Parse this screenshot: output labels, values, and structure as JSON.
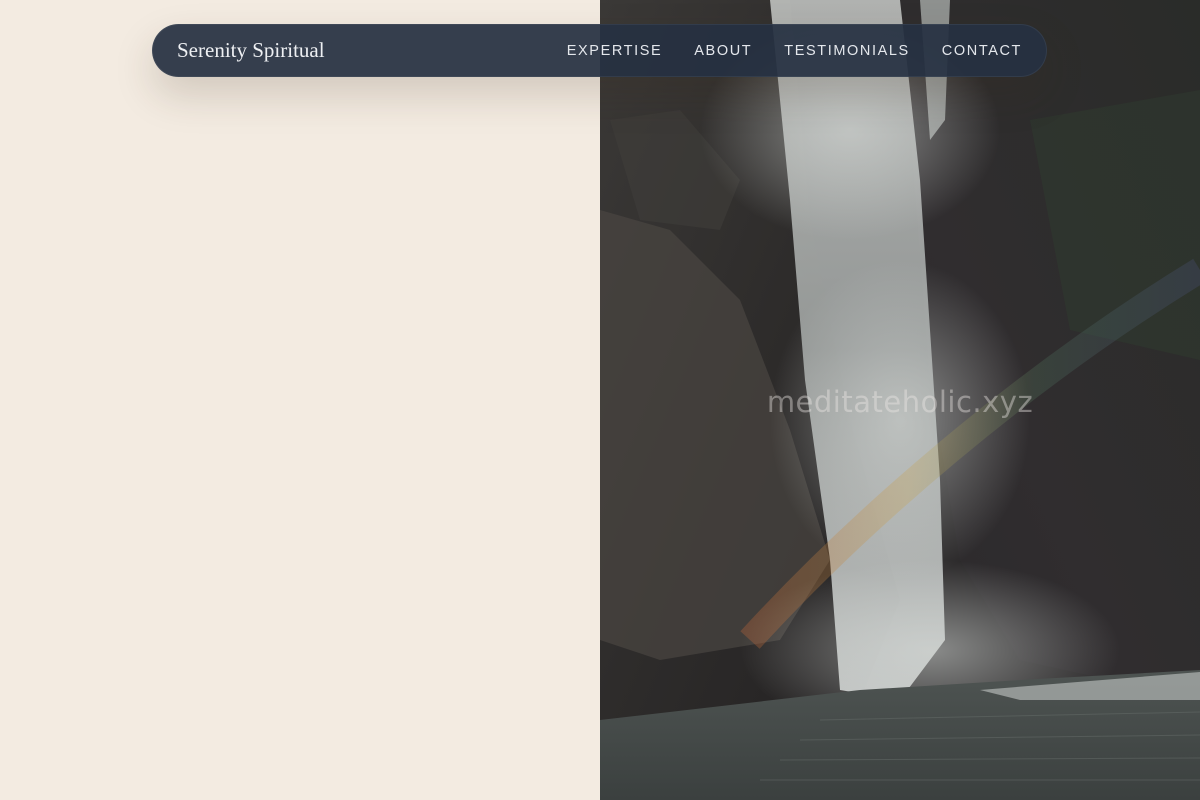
{
  "brand": {
    "name": "Serenity Spiritual"
  },
  "nav": {
    "items": [
      {
        "label": "EXPERTISE"
      },
      {
        "label": "ABOUT"
      },
      {
        "label": "TESTIMONIALS"
      },
      {
        "label": "CONTACT"
      }
    ]
  },
  "hero": {
    "image_subject": "waterfall-with-rainbow-photo",
    "watermark": "meditateholic.xyz"
  },
  "colors": {
    "page_background": "#f3ebe1",
    "navbar_background": "#263042",
    "nav_text": "#e4e7ec"
  }
}
